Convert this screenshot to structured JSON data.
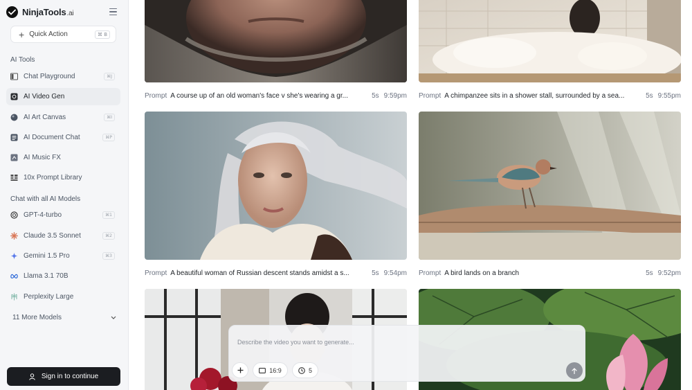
{
  "brand": {
    "name": "NinjaTools",
    "suffix": ".ai"
  },
  "quick_action": {
    "label": "Quick Action",
    "shortcut": "⌘ B"
  },
  "sections": {
    "ai_tools": "AI Tools",
    "chat_models": "Chat with all AI Models"
  },
  "ai_tools": [
    {
      "label": "Chat Playground",
      "shortcut": "⌘J",
      "icon": "book-icon"
    },
    {
      "label": "AI Video Gen",
      "shortcut": "",
      "icon": "video-icon",
      "active": true
    },
    {
      "label": "AI Art Canvas",
      "shortcut": "⌘I",
      "icon": "palette-icon"
    },
    {
      "label": "AI Document Chat",
      "shortcut": "⌘P",
      "icon": "document-icon"
    },
    {
      "label": "AI Music FX",
      "shortcut": "",
      "icon": "music-icon"
    },
    {
      "label": "10x Prompt Library",
      "shortcut": "",
      "icon": "library-icon"
    }
  ],
  "models": [
    {
      "label": "GPT-4-turbo",
      "shortcut": "⌘1",
      "icon": "openai-icon"
    },
    {
      "label": "Claude 3.5 Sonnet",
      "shortcut": "⌘2",
      "icon": "claude-icon"
    },
    {
      "label": "Gemini 1.5 Pro",
      "shortcut": "⌘3",
      "icon": "gemini-icon"
    },
    {
      "label": "Llama 3.1 70B",
      "shortcut": "",
      "icon": "meta-icon"
    },
    {
      "label": "Perplexity Large",
      "shortcut": "",
      "icon": "perplexity-icon"
    }
  ],
  "more_models": "11 More Models",
  "signin": "Sign in to continue",
  "videos": [
    {
      "prompt_label": "Prompt",
      "prompt": "A course up of an old woman's face v she's wearing a gr...",
      "duration": "5s",
      "time": "9:59pm"
    },
    {
      "prompt_label": "Prompt",
      "prompt": "A chimpanzee sits in a shower stall, surrounded by a sea...",
      "duration": "5s",
      "time": "9:55pm"
    },
    {
      "prompt_label": "Prompt",
      "prompt": "A beautiful woman of Russian descent stands amidst a s...",
      "duration": "5s",
      "time": "9:54pm"
    },
    {
      "prompt_label": "Prompt",
      "prompt": "A bird lands on a branch",
      "duration": "5s",
      "time": "9:52pm"
    }
  ],
  "composer": {
    "placeholder": "Describe the video you want to generate...",
    "aspect": "16:9",
    "duration": "5"
  },
  "colors": {
    "sidebar_bg": "#f5f6f8",
    "signin_bg": "#1b1d21",
    "send_bg": "#8f939a"
  }
}
